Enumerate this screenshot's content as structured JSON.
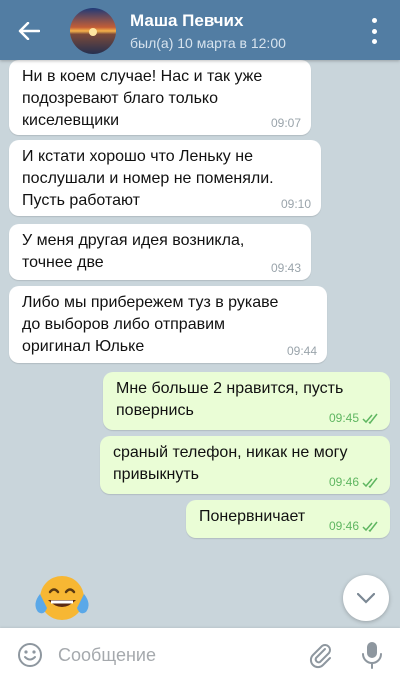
{
  "header": {
    "contact_name": "Маша Певчих",
    "status": "был(а) 10 марта в 12:00"
  },
  "messages": [
    {
      "direction": "in",
      "text": "Ни в коем случае! Нас и так уже\nподозревают благо только\nкиселевщики",
      "time": "09:07"
    },
    {
      "direction": "in",
      "text": "И кстати хорошо что Леньку не\nпослушали и номер не поменяли.\nПусть работают",
      "time": "09:10"
    },
    {
      "direction": "in",
      "text": "У меня другая идея возникла,\nточнее две",
      "time": "09:43"
    },
    {
      "direction": "in",
      "text": "Либо мы прибережем туз в рукаве\nдо выборов либо отправим\nоригинал Юльке",
      "time": "09:44"
    },
    {
      "direction": "out",
      "text": "Мне больше 2 нравится,  пусть\nповернись",
      "time": "09:45",
      "read": true
    },
    {
      "direction": "out",
      "text": "сраный телефон, никак не могу\nпривыкнуть",
      "time": "09:46",
      "read": true
    },
    {
      "direction": "out",
      "text": "Понервничает",
      "time": "09:46",
      "read": true
    }
  ],
  "emoji": "tears-of-joy-emoji",
  "composer": {
    "placeholder": "Сообщение",
    "value": ""
  },
  "colors": {
    "header": "#527da3",
    "chat_background": "#c9d5db",
    "incoming_bubble": "#ffffff",
    "outgoing_bubble": "#eafdd6",
    "read_checks": "#5fb661"
  },
  "icons": [
    "back-arrow-icon",
    "more-vertical-icon",
    "smile-icon",
    "paperclip-icon",
    "microphone-icon",
    "chevron-down-icon",
    "double-check-icon"
  ]
}
